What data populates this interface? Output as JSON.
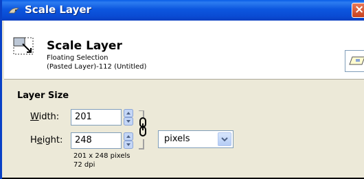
{
  "window": {
    "title": "Scale Layer",
    "close_label": "×"
  },
  "header": {
    "title": "Scale Layer",
    "subtitle": "Floating Selection",
    "layer_info": "(Pasted Layer)-112 (Untitled)"
  },
  "layer_size": {
    "section_title": "Layer Size",
    "width_label_underlined": "W",
    "width_label_rest": "idth:",
    "width_value": "201",
    "height_label_prefix": "H",
    "height_label_underlined": "e",
    "height_label_rest": "ight:",
    "height_value": "248",
    "unit": "pixels",
    "size_info": "201 x 248 pixels",
    "resolution_info": "72 dpi",
    "chain_linked": true
  },
  "icons": {
    "title": "gimp-wilber-icon",
    "header": "scale-layer-icon",
    "preview": "layer-preview-icon",
    "chain": "chain-link-icon",
    "spin": "spin-arrows-icon",
    "dropdown": "chevron-down-icon"
  },
  "colors": {
    "titlebar": "#0a4bd3",
    "dialog_bg": "#ece9d8",
    "close": "#c6401c",
    "input_border": "#7f9db9"
  }
}
